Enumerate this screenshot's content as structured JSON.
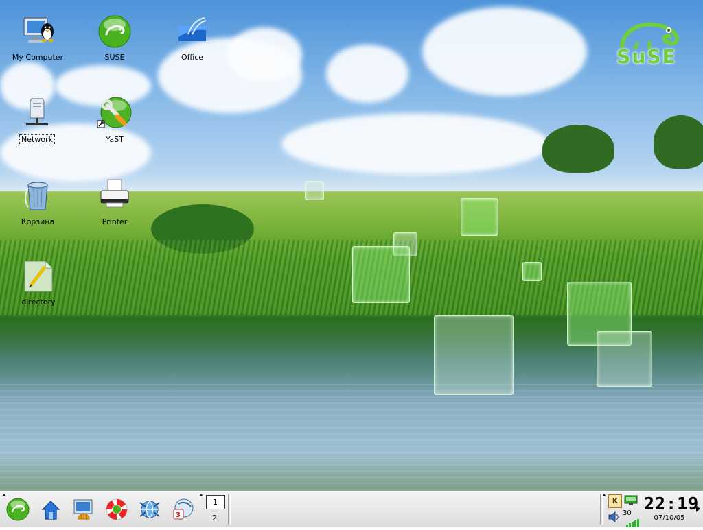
{
  "desktop": {
    "icons": [
      {
        "label": "My Computer"
      },
      {
        "label": "SUSE"
      },
      {
        "label": "Office"
      },
      {
        "label": "Network"
      },
      {
        "label": "YaST"
      },
      {
        "label": "Корзина"
      },
      {
        "label": "Printer"
      },
      {
        "label": "directory"
      }
    ],
    "logo_text": "SuSE"
  },
  "taskbar": {
    "launchers": [
      "suse-menu-icon",
      "home-icon",
      "shell-icon",
      "help-lifebuoy-icon",
      "kde-network-icon",
      "office-presentation-icon"
    ],
    "pager": {
      "desktops": [
        "1",
        "2"
      ],
      "active": "1"
    },
    "tray": {
      "keyboard_label": "K",
      "volume_percent": "30"
    },
    "clock": {
      "time": "22:19",
      "date": "07/10/05"
    }
  },
  "colors": {
    "accent": "#6fcf3a",
    "taskbar": "#e6e6e6"
  }
}
